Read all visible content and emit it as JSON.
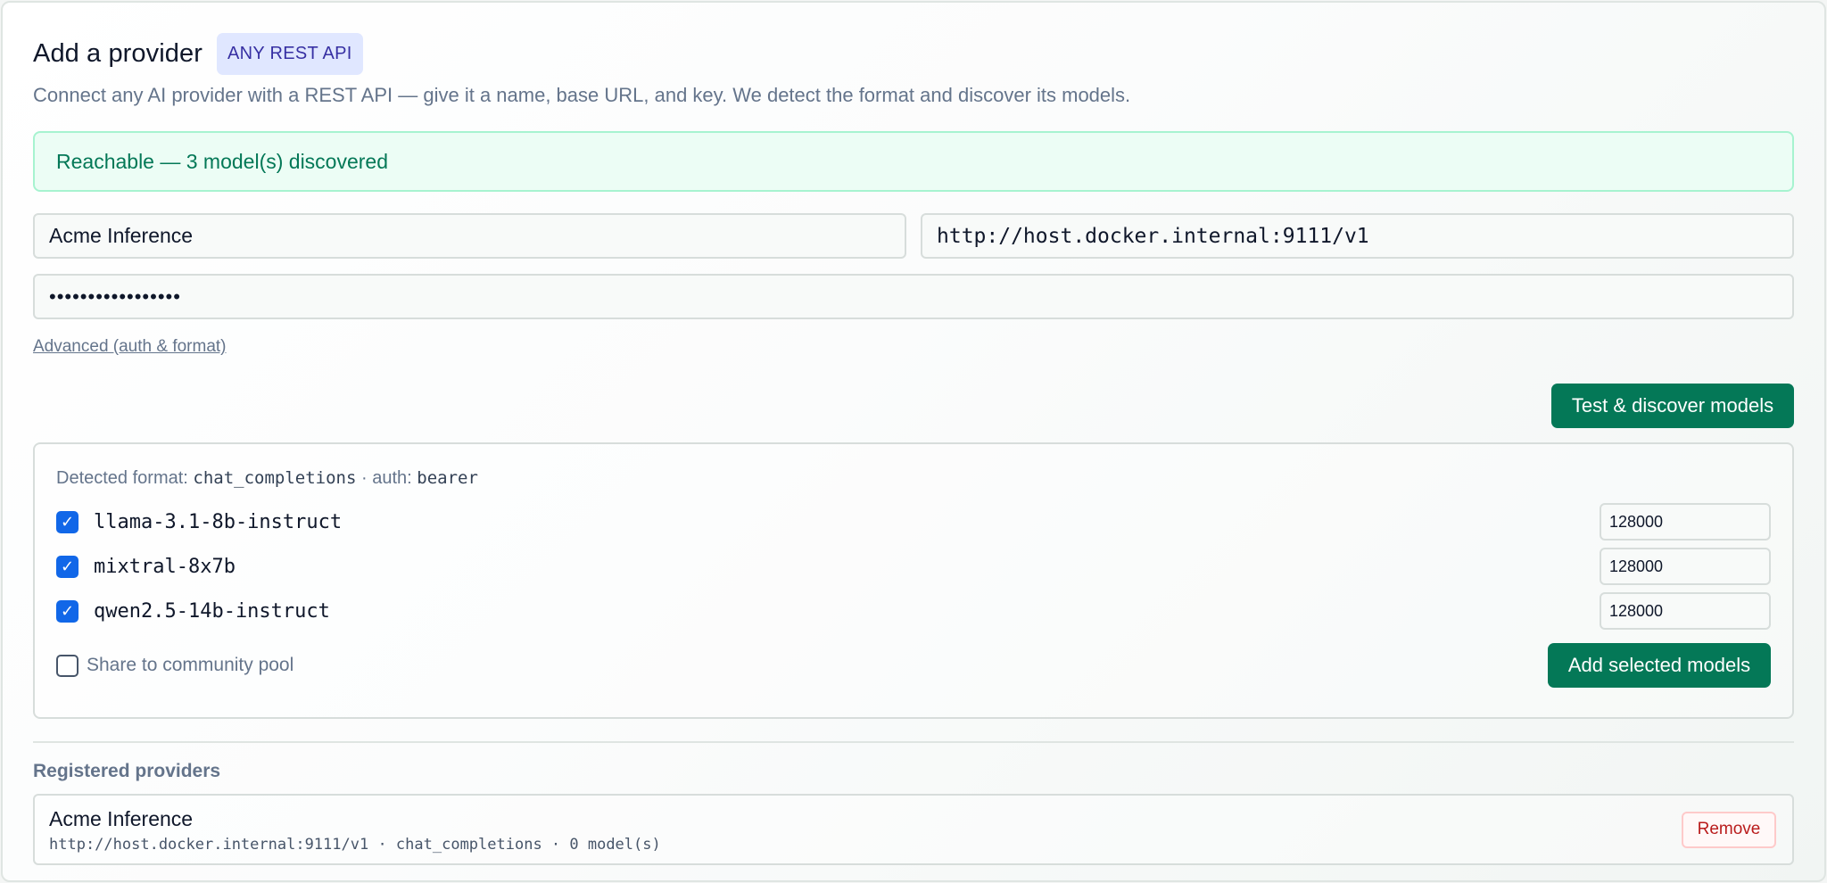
{
  "header": {
    "title": "Add a provider",
    "badge": "ANY REST API",
    "subtitle": "Connect any AI provider with a REST API — give it a name, base URL, and key. We detect the format and discover its models."
  },
  "status": {
    "message": "Reachable — 3 model(s) discovered"
  },
  "form": {
    "name_value": "Acme Inference",
    "base_url_value": "http://host.docker.internal:9111/v1",
    "api_key_masked": "•••••••••••••••••",
    "advanced_link": "Advanced (auth & format)",
    "test_button": "Test & discover models"
  },
  "discovery": {
    "detected_prefix": "Detected format:",
    "format": "chat_completions",
    "auth_prefix": " · auth:",
    "auth": "bearer",
    "models": [
      {
        "name": "llama-3.1-8b-instruct",
        "context": "128000",
        "checked": true
      },
      {
        "name": "mixtral-8x7b",
        "context": "128000",
        "checked": true
      },
      {
        "name": "qwen2.5-14b-instruct",
        "context": "128000",
        "checked": true
      }
    ],
    "share_label": "Share to community pool",
    "add_button": "Add selected models"
  },
  "registered": {
    "title": "Registered providers",
    "providers": [
      {
        "name": "Acme Inference",
        "meta": "http://host.docker.internal:9111/v1 · chat_completions · 0 model(s)",
        "remove_label": "Remove"
      }
    ]
  },
  "colors": {
    "accent_green": "#047857",
    "badge_bg": "#e0e7ff",
    "checkbox_blue": "#1167e8",
    "remove_red": "#b91c1c"
  }
}
